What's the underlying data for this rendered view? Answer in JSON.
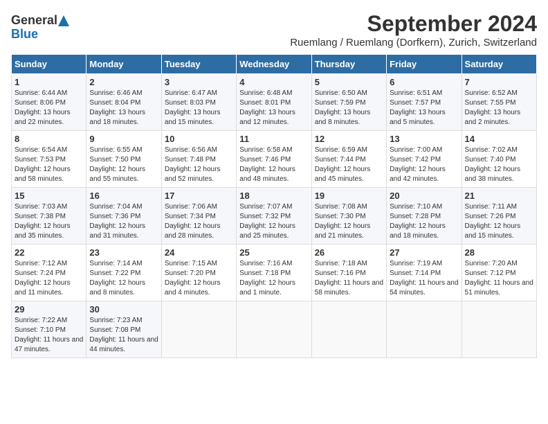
{
  "header": {
    "logo_line1": "General",
    "logo_line2": "Blue",
    "title": "September 2024",
    "subtitle": "Ruemlang / Ruemlang (Dorfkern), Zurich, Switzerland"
  },
  "columns": [
    "Sunday",
    "Monday",
    "Tuesday",
    "Wednesday",
    "Thursday",
    "Friday",
    "Saturday"
  ],
  "weeks": [
    [
      {
        "day": "1",
        "sunrise": "6:44 AM",
        "sunset": "8:06 PM",
        "daylight": "13 hours and 22 minutes."
      },
      {
        "day": "2",
        "sunrise": "6:46 AM",
        "sunset": "8:04 PM",
        "daylight": "13 hours and 18 minutes."
      },
      {
        "day": "3",
        "sunrise": "6:47 AM",
        "sunset": "8:03 PM",
        "daylight": "13 hours and 15 minutes."
      },
      {
        "day": "4",
        "sunrise": "6:48 AM",
        "sunset": "8:01 PM",
        "daylight": "13 hours and 12 minutes."
      },
      {
        "day": "5",
        "sunrise": "6:50 AM",
        "sunset": "7:59 PM",
        "daylight": "13 hours and 8 minutes."
      },
      {
        "day": "6",
        "sunrise": "6:51 AM",
        "sunset": "7:57 PM",
        "daylight": "13 hours and 5 minutes."
      },
      {
        "day": "7",
        "sunrise": "6:52 AM",
        "sunset": "7:55 PM",
        "daylight": "13 hours and 2 minutes."
      }
    ],
    [
      {
        "day": "8",
        "sunrise": "6:54 AM",
        "sunset": "7:53 PM",
        "daylight": "12 hours and 58 minutes."
      },
      {
        "day": "9",
        "sunrise": "6:55 AM",
        "sunset": "7:50 PM",
        "daylight": "12 hours and 55 minutes."
      },
      {
        "day": "10",
        "sunrise": "6:56 AM",
        "sunset": "7:48 PM",
        "daylight": "12 hours and 52 minutes."
      },
      {
        "day": "11",
        "sunrise": "6:58 AM",
        "sunset": "7:46 PM",
        "daylight": "12 hours and 48 minutes."
      },
      {
        "day": "12",
        "sunrise": "6:59 AM",
        "sunset": "7:44 PM",
        "daylight": "12 hours and 45 minutes."
      },
      {
        "day": "13",
        "sunrise": "7:00 AM",
        "sunset": "7:42 PM",
        "daylight": "12 hours and 42 minutes."
      },
      {
        "day": "14",
        "sunrise": "7:02 AM",
        "sunset": "7:40 PM",
        "daylight": "12 hours and 38 minutes."
      }
    ],
    [
      {
        "day": "15",
        "sunrise": "7:03 AM",
        "sunset": "7:38 PM",
        "daylight": "12 hours and 35 minutes."
      },
      {
        "day": "16",
        "sunrise": "7:04 AM",
        "sunset": "7:36 PM",
        "daylight": "12 hours and 31 minutes."
      },
      {
        "day": "17",
        "sunrise": "7:06 AM",
        "sunset": "7:34 PM",
        "daylight": "12 hours and 28 minutes."
      },
      {
        "day": "18",
        "sunrise": "7:07 AM",
        "sunset": "7:32 PM",
        "daylight": "12 hours and 25 minutes."
      },
      {
        "day": "19",
        "sunrise": "7:08 AM",
        "sunset": "7:30 PM",
        "daylight": "12 hours and 21 minutes."
      },
      {
        "day": "20",
        "sunrise": "7:10 AM",
        "sunset": "7:28 PM",
        "daylight": "12 hours and 18 minutes."
      },
      {
        "day": "21",
        "sunrise": "7:11 AM",
        "sunset": "7:26 PM",
        "daylight": "12 hours and 15 minutes."
      }
    ],
    [
      {
        "day": "22",
        "sunrise": "7:12 AM",
        "sunset": "7:24 PM",
        "daylight": "12 hours and 11 minutes."
      },
      {
        "day": "23",
        "sunrise": "7:14 AM",
        "sunset": "7:22 PM",
        "daylight": "12 hours and 8 minutes."
      },
      {
        "day": "24",
        "sunrise": "7:15 AM",
        "sunset": "7:20 PM",
        "daylight": "12 hours and 4 minutes."
      },
      {
        "day": "25",
        "sunrise": "7:16 AM",
        "sunset": "7:18 PM",
        "daylight": "12 hours and 1 minute."
      },
      {
        "day": "26",
        "sunrise": "7:18 AM",
        "sunset": "7:16 PM",
        "daylight": "11 hours and 58 minutes."
      },
      {
        "day": "27",
        "sunrise": "7:19 AM",
        "sunset": "7:14 PM",
        "daylight": "11 hours and 54 minutes."
      },
      {
        "day": "28",
        "sunrise": "7:20 AM",
        "sunset": "7:12 PM",
        "daylight": "11 hours and 51 minutes."
      }
    ],
    [
      {
        "day": "29",
        "sunrise": "7:22 AM",
        "sunset": "7:10 PM",
        "daylight": "11 hours and 47 minutes."
      },
      {
        "day": "30",
        "sunrise": "7:23 AM",
        "sunset": "7:08 PM",
        "daylight": "11 hours and 44 minutes."
      },
      null,
      null,
      null,
      null,
      null
    ]
  ]
}
